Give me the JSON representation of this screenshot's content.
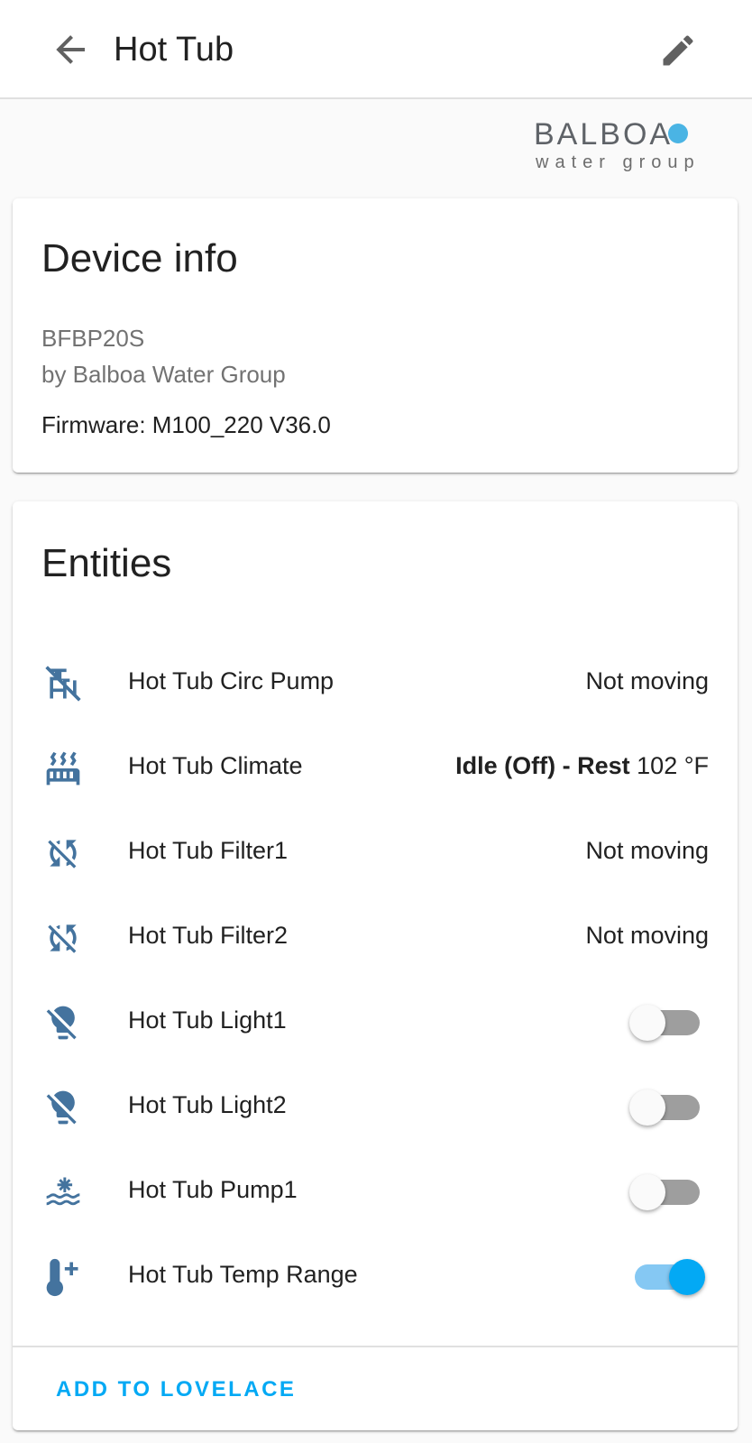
{
  "header": {
    "title": "Hot Tub"
  },
  "brand": {
    "logo_word": "BALBOA",
    "logo_tagline": "water group"
  },
  "device_info": {
    "title": "Device info",
    "model": "BFBP20S",
    "manufacturer": "by Balboa Water Group",
    "firmware": "Firmware: M100_220 V36.0"
  },
  "entities": {
    "title": "Entities",
    "items": [
      {
        "icon": "pump-off-icon",
        "name": "Hot Tub Circ Pump",
        "state": "Not moving"
      },
      {
        "icon": "radiator-icon",
        "name": "Hot Tub Climate",
        "state_bold": "Idle (Off) - Rest",
        "state": "102 °F"
      },
      {
        "icon": "sync-off-icon",
        "name": "Hot Tub Filter1",
        "state": "Not moving"
      },
      {
        "icon": "sync-off-icon",
        "name": "Hot Tub Filter2",
        "state": "Not moving"
      },
      {
        "icon": "lightbulb-off-icon",
        "name": "Hot Tub Light1",
        "toggle": false
      },
      {
        "icon": "lightbulb-off-icon",
        "name": "Hot Tub Light2",
        "toggle": false
      },
      {
        "icon": "hot-tub-jet-icon",
        "name": "Hot Tub Pump1",
        "toggle": false
      },
      {
        "icon": "thermometer-plus-icon",
        "name": "Hot Tub Temp Range",
        "toggle": true
      }
    ],
    "add_button": "ADD TO LOVELACE"
  },
  "colors": {
    "accent": "#03a9f4",
    "icon": "#44739e",
    "toggle_off_track": "#9e9e9e",
    "toggle_on_track": "#85c8f3"
  }
}
